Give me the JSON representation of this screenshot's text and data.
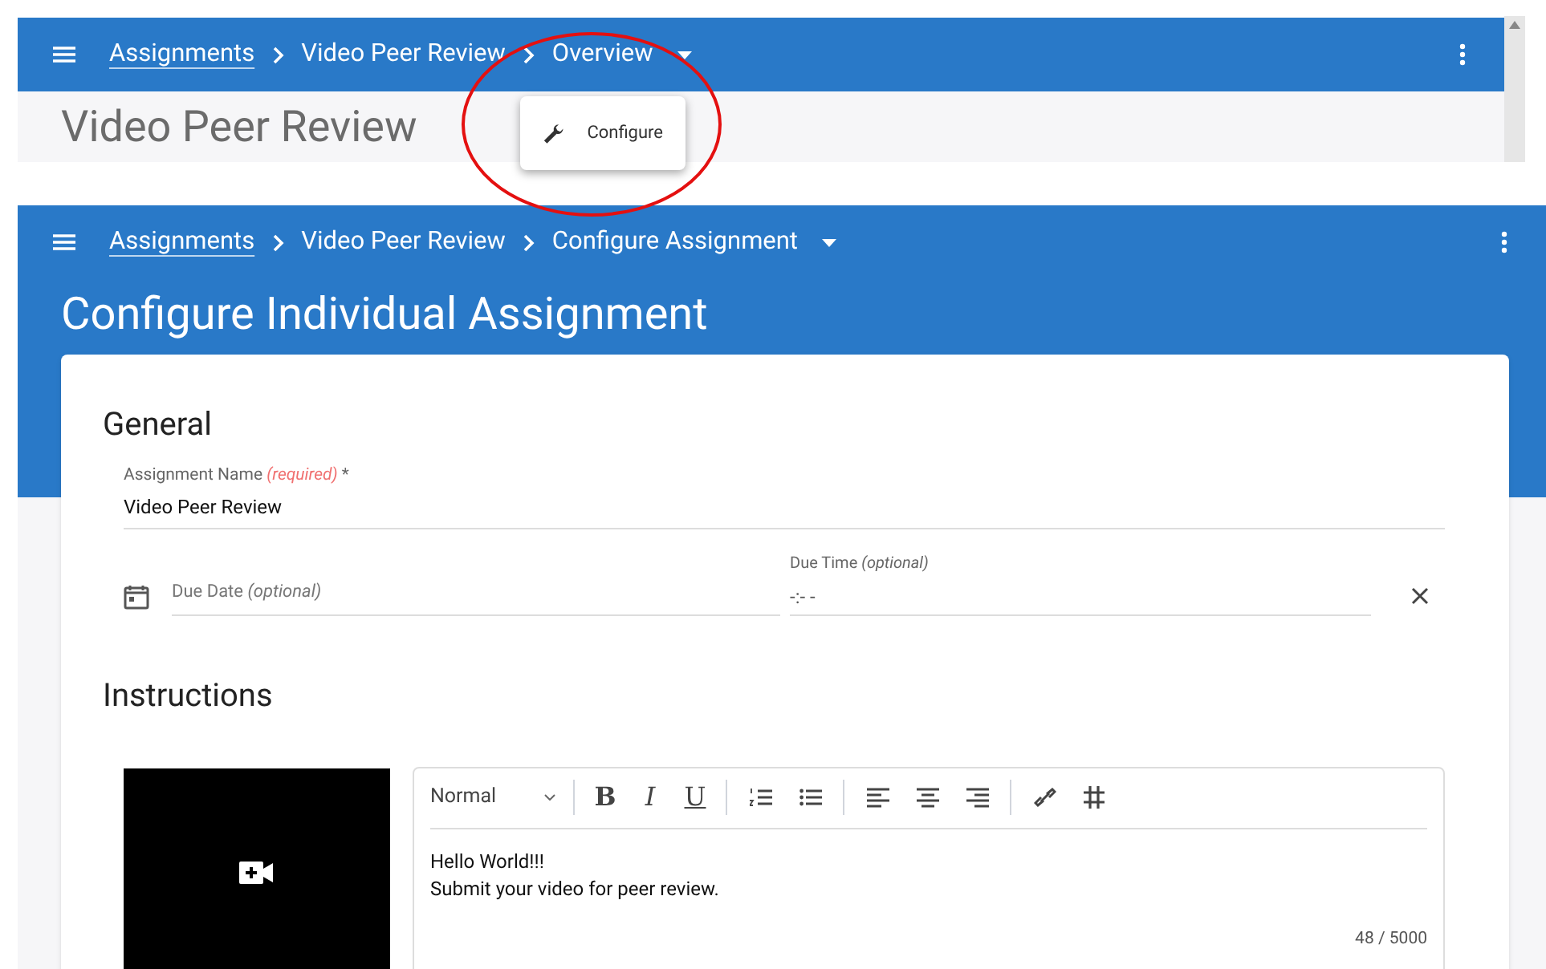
{
  "top_screen": {
    "breadcrumbs": [
      {
        "label": "Assignments",
        "kind": "link"
      },
      {
        "label": "Video Peer Review",
        "kind": "text"
      },
      {
        "label": "Overview",
        "kind": "text"
      }
    ],
    "page_title": "Video Peer Review",
    "menu": [
      {
        "label": "Configure"
      }
    ]
  },
  "bottom_screen": {
    "breadcrumbs": [
      {
        "label": "Assignments",
        "kind": "link"
      },
      {
        "label": "Video Peer Review",
        "kind": "text"
      },
      {
        "label": "Configure Assignment",
        "kind": "text"
      }
    ],
    "page_title": "Configure Individual Assignment",
    "general": {
      "heading": "General",
      "assignment_name": {
        "label": "Assignment Name",
        "note": "(required)",
        "marker": "*",
        "value": "Video Peer Review"
      },
      "due_date": {
        "placeholder": "Due Date *(optional)*"
      },
      "due_time": {
        "label": "Due Time *(optional)*",
        "value": "-:- -"
      }
    },
    "instructions": {
      "heading": "Instructions",
      "editor": {
        "format": "Normal",
        "tools": [
          {
            "kind": "bold",
            "label": "B"
          },
          {
            "kind": "italic",
            "label": "I"
          },
          {
            "kind": "underline",
            "label": "U"
          },
          {
            "kind": "separator"
          },
          {
            "kind": "ordered-list"
          },
          {
            "kind": "bullet-list"
          },
          {
            "kind": "separator"
          },
          {
            "kind": "align-left"
          },
          {
            "kind": "align-center"
          },
          {
            "kind": "align-right"
          },
          {
            "kind": "separator"
          },
          {
            "kind": "link"
          },
          {
            "kind": "hashtag"
          }
        ],
        "lines": [
          "Hello World!!!",
          "Submit your video for peer review."
        ],
        "counter": "48 / 5000"
      }
    }
  }
}
